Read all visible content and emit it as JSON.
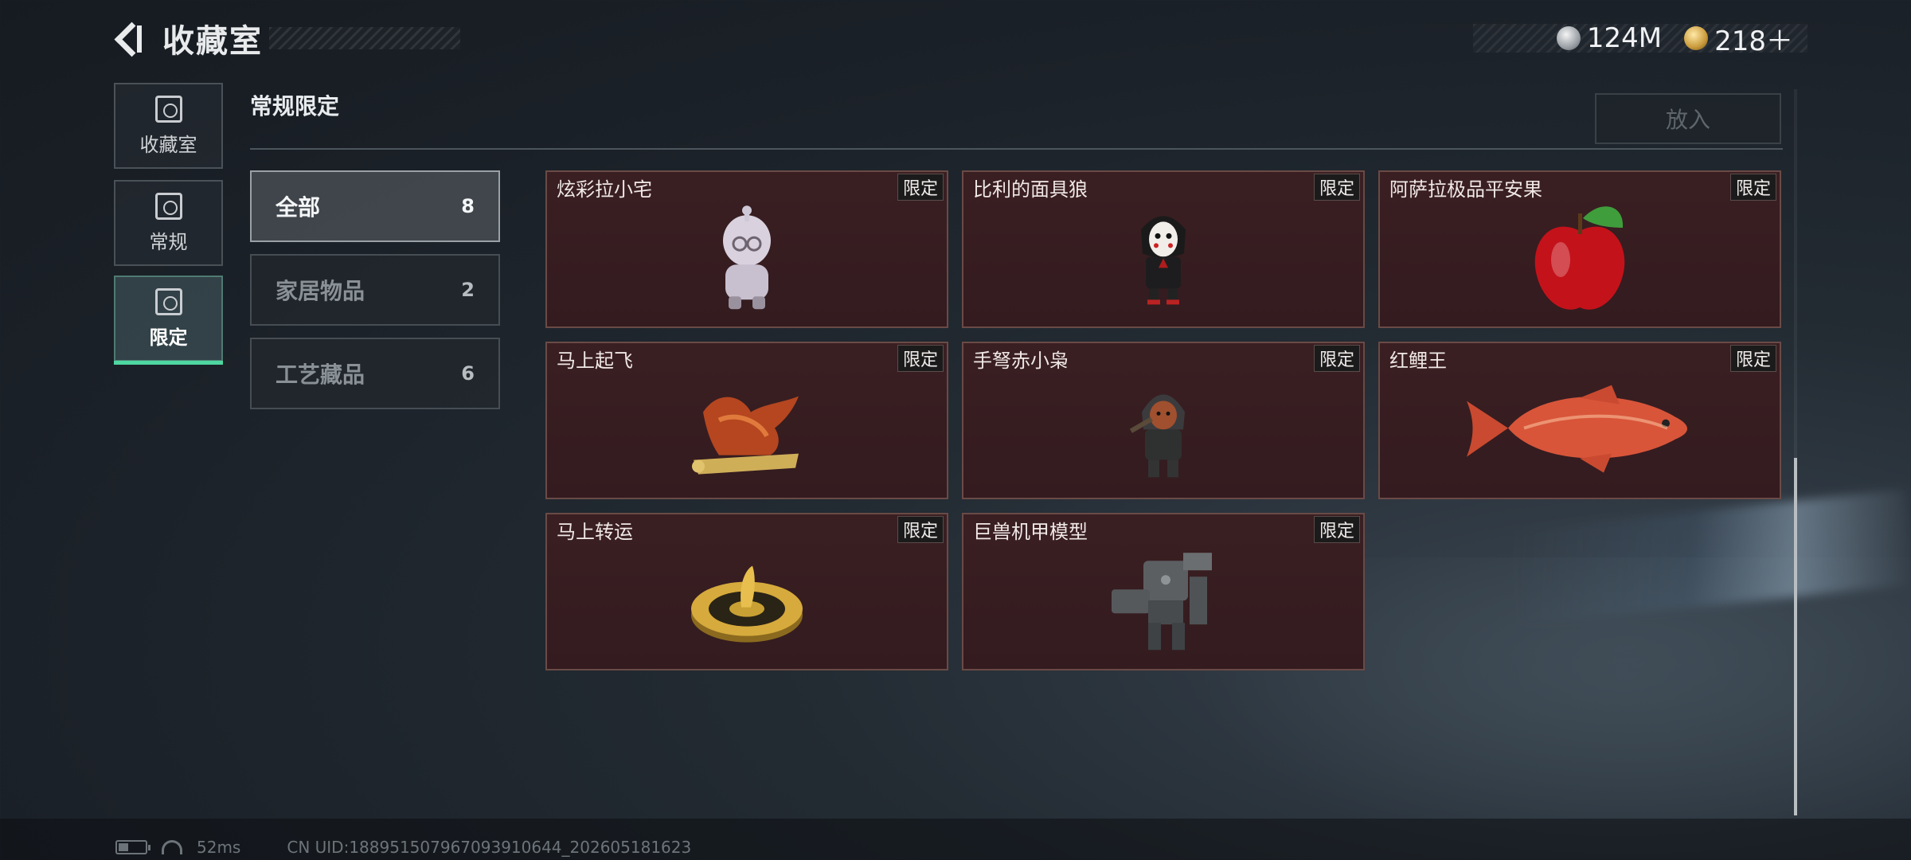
{
  "header": {
    "title": "收藏室",
    "back_icon": "back-arrow-icon"
  },
  "currency": [
    {
      "icon": "silver-coin-icon",
      "value": "124M"
    },
    {
      "icon": "gold-coin-icon",
      "value": "218＋"
    }
  ],
  "side_tabs": [
    {
      "label": "收藏室",
      "icon": "collection-icon",
      "active": false
    },
    {
      "label": "常规",
      "icon": "regular-icon",
      "active": false
    },
    {
      "label": "限定",
      "icon": "limited-icon",
      "active": true
    }
  ],
  "section": {
    "title": "常规限定",
    "put_button": "放入"
  },
  "categories": [
    {
      "label": "全部",
      "count": "8",
      "active": true
    },
    {
      "label": "家居物品",
      "count": "2",
      "active": false
    },
    {
      "label": "工艺藏品",
      "count": "6",
      "active": false
    }
  ],
  "items": [
    {
      "name": "炫彩拉小宅",
      "badge": "限定",
      "icon": "figurine-kid-icon"
    },
    {
      "name": "比利的面具狼",
      "badge": "限定",
      "icon": "mask-figure-icon"
    },
    {
      "name": "阿萨拉极品平安果",
      "badge": "限定",
      "icon": "apple-icon"
    },
    {
      "name": "马上起飞",
      "badge": "限定",
      "icon": "horse-sculpture-icon"
    },
    {
      "name": "手弩赤小枭",
      "badge": "限定",
      "icon": "hooded-figure-icon"
    },
    {
      "name": "红鲤王",
      "badge": "限定",
      "icon": "carp-fish-icon"
    },
    {
      "name": "马上转运",
      "badge": "限定",
      "icon": "golden-wheel-icon"
    },
    {
      "name": "巨兽机甲模型",
      "badge": "限定",
      "icon": "mech-model-icon"
    }
  ],
  "status": {
    "ping": "52ms",
    "uid": "CN UID:1889515079670939106​44_202605181623"
  },
  "colors": {
    "accent": "#4ed7a1",
    "card_bg": "#3a1f22",
    "card_border": "#6a4a46"
  }
}
